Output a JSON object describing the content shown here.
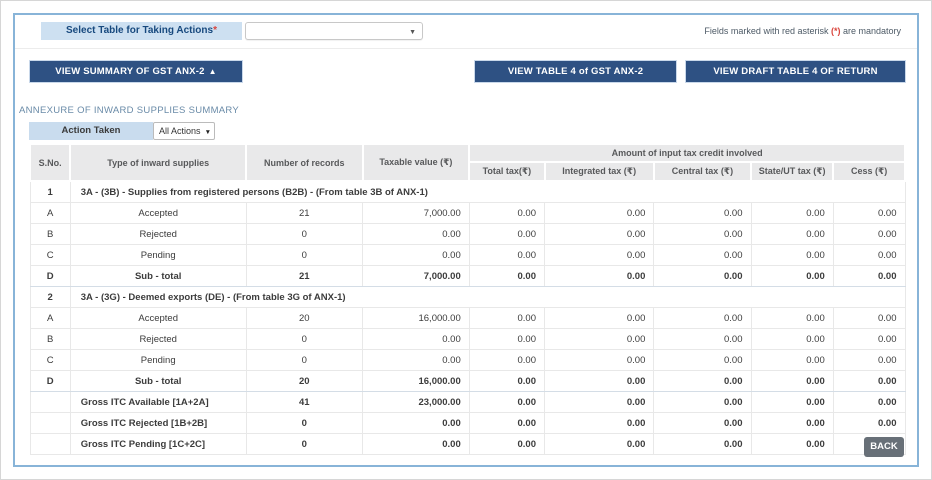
{
  "notices": {
    "mandatory_prefix": "Fields marked with red asterisk ",
    "mandatory_asterisk": "(*)",
    "mandatory_suffix": " are mandatory"
  },
  "top_bar": {
    "select_label": "Select Table for Taking Actions",
    "required_asterisk": "*",
    "select_value": ""
  },
  "buttons": {
    "view_summary": "VIEW SUMMARY OF GST ANX-2",
    "view_table4": "VIEW TABLE 4 of GST ANX-2",
    "view_draft": "VIEW DRAFT TABLE 4 OF RETURN",
    "back": "BACK"
  },
  "icons": {
    "collapse_caret": "▲",
    "dropdown_caret": "▼"
  },
  "section": {
    "title": "ANNEXURE OF INWARD SUPPLIES SUMMARY",
    "filter_label": "Action Taken",
    "filter_value": "All Actions"
  },
  "table": {
    "columns": {
      "sno": "S.No.",
      "type": "Type of inward supplies",
      "records": "Number of records",
      "taxable": "Taxable value (₹)",
      "itc_group": "Amount of input tax credit involved",
      "total_tax": "Total tax(₹)",
      "integrated_tax": "Integrated tax (₹)",
      "central_tax": "Central tax (₹)",
      "state_tax": "State/UT tax (₹)",
      "cess": "Cess (₹)"
    },
    "rows": [
      {
        "kind": "section",
        "sno": "1",
        "label": "3A - (3B) - Supplies from registered persons (B2B) - (From table 3B of ANX-1)"
      },
      {
        "kind": "item",
        "sno": "A",
        "label": "Accepted",
        "records": "21",
        "values": [
          "7,000.00",
          "0.00",
          "0.00",
          "0.00",
          "0.00",
          "0.00"
        ]
      },
      {
        "kind": "item",
        "sno": "B",
        "label": "Rejected",
        "records": "0",
        "values": [
          "0.00",
          "0.00",
          "0.00",
          "0.00",
          "0.00",
          "0.00"
        ]
      },
      {
        "kind": "item",
        "sno": "C",
        "label": "Pending",
        "records": "0",
        "values": [
          "0.00",
          "0.00",
          "0.00",
          "0.00",
          "0.00",
          "0.00"
        ]
      },
      {
        "kind": "subtotal",
        "sno": "D",
        "label": "Sub - total",
        "records": "21",
        "values": [
          "7,000.00",
          "0.00",
          "0.00",
          "0.00",
          "0.00",
          "0.00"
        ]
      },
      {
        "kind": "section",
        "sno": "2",
        "label": "3A - (3G) - Deemed exports (DE) - (From table 3G of ANX-1)"
      },
      {
        "kind": "item",
        "sno": "A",
        "label": "Accepted",
        "records": "20",
        "values": [
          "16,000.00",
          "0.00",
          "0.00",
          "0.00",
          "0.00",
          "0.00"
        ]
      },
      {
        "kind": "item",
        "sno": "B",
        "label": "Rejected",
        "records": "0",
        "values": [
          "0.00",
          "0.00",
          "0.00",
          "0.00",
          "0.00",
          "0.00"
        ]
      },
      {
        "kind": "item",
        "sno": "C",
        "label": "Pending",
        "records": "0",
        "values": [
          "0.00",
          "0.00",
          "0.00",
          "0.00",
          "0.00",
          "0.00"
        ]
      },
      {
        "kind": "subtotal",
        "sno": "D",
        "label": "Sub - total",
        "records": "20",
        "values": [
          "16,000.00",
          "0.00",
          "0.00",
          "0.00",
          "0.00",
          "0.00"
        ]
      },
      {
        "kind": "summary",
        "sno": "",
        "label": "Gross ITC Available [1A+2A]",
        "records": "41",
        "values": [
          "23,000.00",
          "0.00",
          "0.00",
          "0.00",
          "0.00",
          "0.00"
        ]
      },
      {
        "kind": "summary",
        "sno": "",
        "label": "Gross ITC Rejected [1B+2B]",
        "records": "0",
        "values": [
          "0.00",
          "0.00",
          "0.00",
          "0.00",
          "0.00",
          "0.00"
        ]
      },
      {
        "kind": "summary",
        "sno": "",
        "label": "Gross ITC Pending [1C+2C]",
        "records": "0",
        "values": [
          "0.00",
          "0.00",
          "0.00",
          "0.00",
          "0.00",
          "0.00"
        ]
      }
    ]
  },
  "colors": {
    "accent_navy": "#2e5183",
    "label_blue": "#cde0f1",
    "container_border_blue": "#88b4d8",
    "mandatory_red": "#d9453d",
    "header_gray": "#e9e9ea",
    "back_gray": "#687078",
    "title_steel_blue": "#6a8ba8"
  }
}
